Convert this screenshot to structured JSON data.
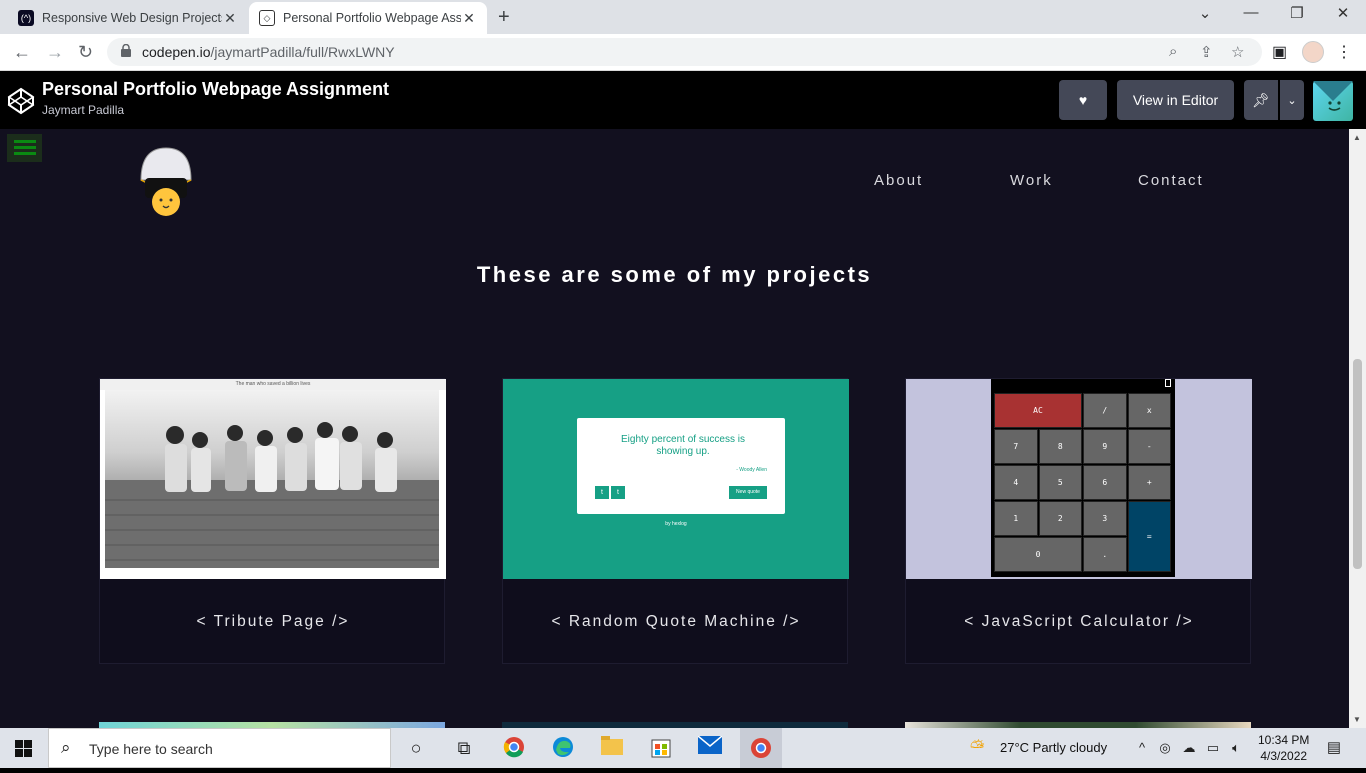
{
  "browser": {
    "tabs": [
      {
        "title": "Responsive Web Design Projects",
        "active": false
      },
      {
        "title": "Personal Portfolio Webpage Assig",
        "active": true
      }
    ],
    "url_host": "codepen.io",
    "url_path": "/jaymartPadilla/full/RwxLWNY"
  },
  "codepen": {
    "title": "Personal Portfolio Webpage Assignment",
    "author": "Jaymart Padilla",
    "view_in_editor": "View in Editor"
  },
  "page": {
    "nav": [
      "About",
      "Work",
      "Contact"
    ],
    "section_title": "These are some of my projects",
    "projects": [
      {
        "caption": "< Tribute Page />",
        "thumb_caption": "The man who saved a billion lives"
      },
      {
        "caption": "< Random Quote Machine />",
        "quote": "Eighty percent of success is showing up.",
        "quote_author": "- Woody Allen",
        "new_quote": "New quote",
        "footer": "by hexlog"
      },
      {
        "caption": "< JavaScript Calculator />",
        "keys": [
          "AC",
          "/",
          "x",
          "7",
          "8",
          "9",
          "-",
          "4",
          "5",
          "6",
          "+",
          "1",
          "2",
          "3",
          "=",
          "0",
          "."
        ]
      }
    ]
  },
  "taskbar": {
    "search_placeholder": "Type here to search",
    "weather": "27°C  Partly cloudy",
    "time": "10:34 PM",
    "date": "4/3/2022"
  },
  "colors": {
    "page_bg": "#12101f",
    "quote_green": "#16a085",
    "calc_red": "#a83232",
    "calc_blue": "#004466"
  }
}
